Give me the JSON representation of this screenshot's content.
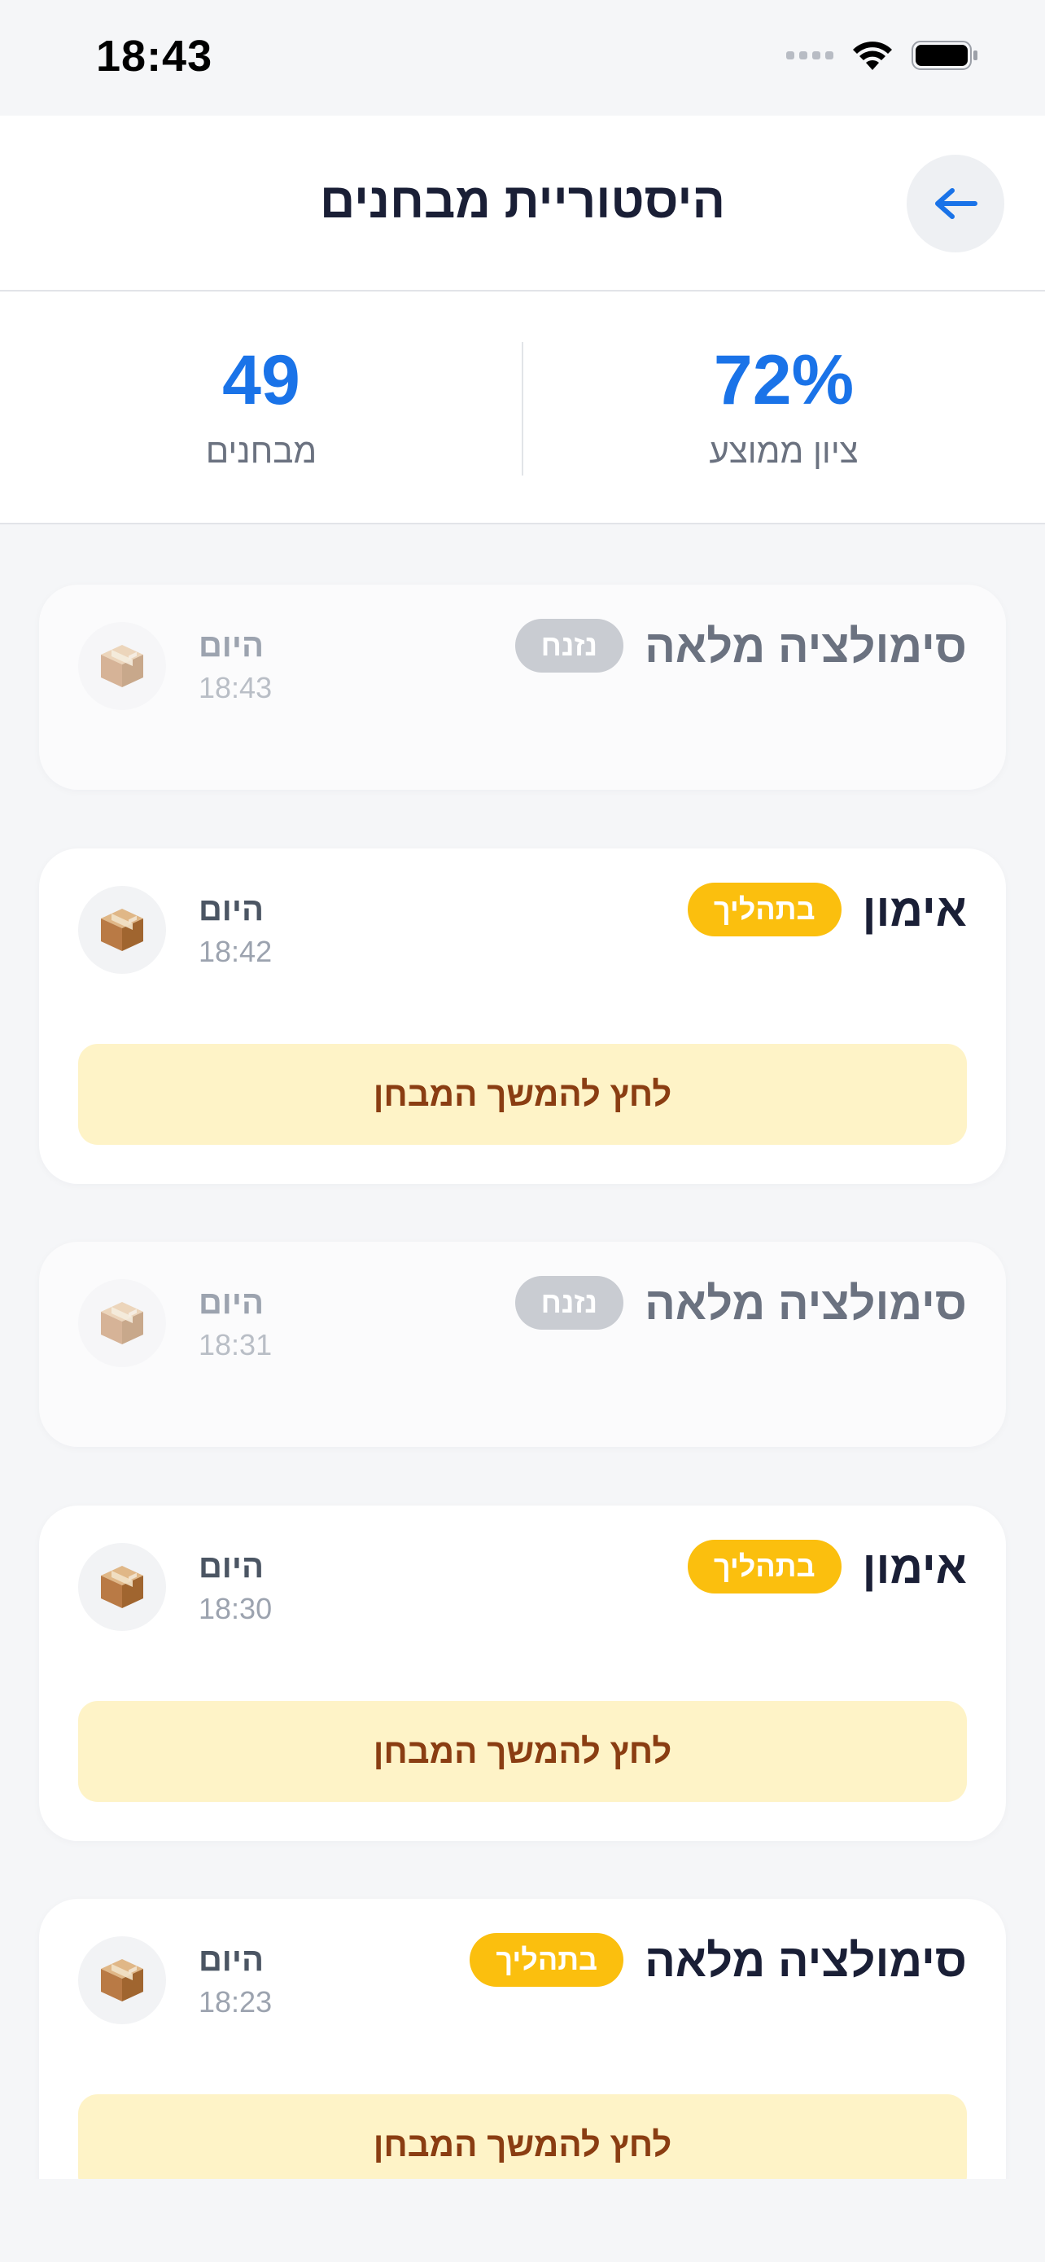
{
  "status_bar": {
    "time": "18:43"
  },
  "header": {
    "title": "היסטוריית מבחנים"
  },
  "stats": {
    "average": {
      "value": "72%",
      "label": "ציון ממוצע"
    },
    "count": {
      "value": "49",
      "label": "מבחנים"
    }
  },
  "colors": {
    "accent": "#1a73e8",
    "in_progress": "#fbbf0e",
    "abandoned": "#c9ccd2",
    "continue_bg": "#fef3c7",
    "continue_text": "#8a3d12"
  },
  "tests": [
    {
      "title": "סימולציה מלאה",
      "status": "נזנח",
      "day": "היום",
      "time": "18:43",
      "icon": "package-icon"
    },
    {
      "title": "אימון",
      "status": "בתהליך",
      "day": "היום",
      "time": "18:42",
      "icon": "package-icon",
      "action": "לחץ להמשך המבחן"
    },
    {
      "title": "סימולציה מלאה",
      "status": "נזנח",
      "day": "היום",
      "time": "18:31",
      "icon": "package-icon"
    },
    {
      "title": "אימון",
      "status": "בתהליך",
      "day": "היום",
      "time": "18:30",
      "icon": "package-icon",
      "action": "לחץ להמשך המבחן"
    },
    {
      "title": "סימולציה מלאה",
      "status": "בתהליך",
      "day": "היום",
      "time": "18:23",
      "icon": "package-icon",
      "action": "לחץ להמשך המבחן"
    }
  ]
}
